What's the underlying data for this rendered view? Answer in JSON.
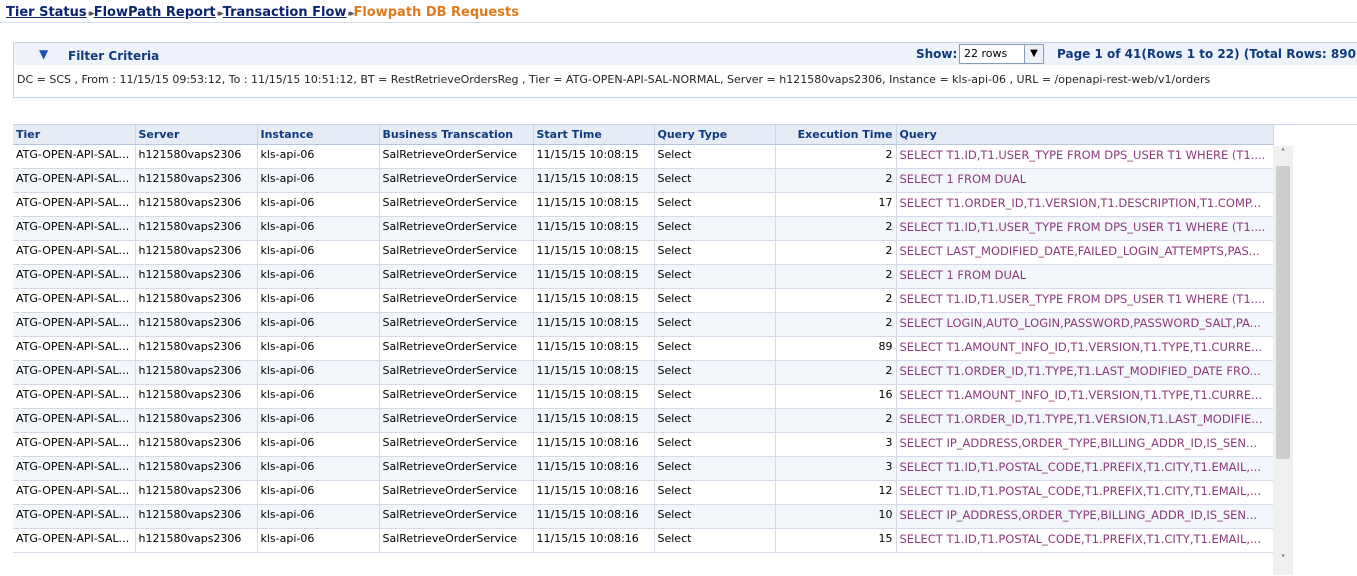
{
  "breadcrumb": {
    "items": [
      "Tier Status",
      "FlowPath Report",
      "Transaction Flow"
    ],
    "current": "Flowpath DB Requests",
    "separator": "▸▸"
  },
  "filter": {
    "title": "Filter Criteria",
    "toggle_icon": "▼",
    "show_label": "Show:",
    "show_value": "22 rows",
    "page_info": "Page 1 of 41(Rows 1 to 22) (Total Rows: 890)",
    "criteria": "DC = SCS , From : 11/15/15 09:53:12, To : 11/15/15 10:51:12, BT = RestRetrieveOrdersReg , Tier = ATG-OPEN-API-SAL-NORMAL, Server = h121580vaps2306, Instance = kls-api-06 , URL = /openapi-rest-web/v1/orders"
  },
  "table": {
    "columns": [
      "Tier",
      "Server",
      "Instance",
      "Business Transcation",
      "Start Time",
      "Query Type",
      "Execution Time",
      "Query"
    ],
    "rows": [
      [
        "ATG-OPEN-API-SAL-...",
        "h121580vaps2306",
        "kls-api-06",
        "SalRetrieveOrderService",
        "11/15/15 10:08:15",
        "Select",
        "2",
        "SELECT T1.ID,T1.USER_TYPE FROM DPS_USER T1 WHERE (T1...."
      ],
      [
        "ATG-OPEN-API-SAL-...",
        "h121580vaps2306",
        "kls-api-06",
        "SalRetrieveOrderService",
        "11/15/15 10:08:15",
        "Select",
        "2",
        "SELECT 1 FROM DUAL"
      ],
      [
        "ATG-OPEN-API-SAL-...",
        "h121580vaps2306",
        "kls-api-06",
        "SalRetrieveOrderService",
        "11/15/15 10:08:15",
        "Select",
        "17",
        "SELECT T1.ORDER_ID,T1.VERSION,T1.DESCRIPTION,T1.COMP..."
      ],
      [
        "ATG-OPEN-API-SAL-...",
        "h121580vaps2306",
        "kls-api-06",
        "SalRetrieveOrderService",
        "11/15/15 10:08:15",
        "Select",
        "2",
        "SELECT T1.ID,T1.USER_TYPE FROM DPS_USER T1 WHERE (T1...."
      ],
      [
        "ATG-OPEN-API-SAL-...",
        "h121580vaps2306",
        "kls-api-06",
        "SalRetrieveOrderService",
        "11/15/15 10:08:15",
        "Select",
        "2",
        "SELECT LAST_MODIFIED_DATE,FAILED_LOGIN_ATTEMPTS,PAS..."
      ],
      [
        "ATG-OPEN-API-SAL-...",
        "h121580vaps2306",
        "kls-api-06",
        "SalRetrieveOrderService",
        "11/15/15 10:08:15",
        "Select",
        "2",
        "SELECT 1 FROM DUAL"
      ],
      [
        "ATG-OPEN-API-SAL-...",
        "h121580vaps2306",
        "kls-api-06",
        "SalRetrieveOrderService",
        "11/15/15 10:08:15",
        "Select",
        "2",
        "SELECT T1.ID,T1.USER_TYPE FROM DPS_USER T1 WHERE (T1...."
      ],
      [
        "ATG-OPEN-API-SAL-...",
        "h121580vaps2306",
        "kls-api-06",
        "SalRetrieveOrderService",
        "11/15/15 10:08:15",
        "Select",
        "2",
        "SELECT LOGIN,AUTO_LOGIN,PASSWORD,PASSWORD_SALT,PA..."
      ],
      [
        "ATG-OPEN-API-SAL-...",
        "h121580vaps2306",
        "kls-api-06",
        "SalRetrieveOrderService",
        "11/15/15 10:08:15",
        "Select",
        "89",
        "SELECT T1.AMOUNT_INFO_ID,T1.VERSION,T1.TYPE,T1.CURRE..."
      ],
      [
        "ATG-OPEN-API-SAL-...",
        "h121580vaps2306",
        "kls-api-06",
        "SalRetrieveOrderService",
        "11/15/15 10:08:15",
        "Select",
        "2",
        "SELECT T1.ORDER_ID,T1.TYPE,T1.LAST_MODIFIED_DATE FRO..."
      ],
      [
        "ATG-OPEN-API-SAL-...",
        "h121580vaps2306",
        "kls-api-06",
        "SalRetrieveOrderService",
        "11/15/15 10:08:15",
        "Select",
        "16",
        "SELECT T1.AMOUNT_INFO_ID,T1.VERSION,T1.TYPE,T1.CURRE..."
      ],
      [
        "ATG-OPEN-API-SAL-...",
        "h121580vaps2306",
        "kls-api-06",
        "SalRetrieveOrderService",
        "11/15/15 10:08:15",
        "Select",
        "2",
        "SELECT T1.ORDER_ID,T1.TYPE,T1.VERSION,T1.LAST_MODIFIE..."
      ],
      [
        "ATG-OPEN-API-SAL-...",
        "h121580vaps2306",
        "kls-api-06",
        "SalRetrieveOrderService",
        "11/15/15 10:08:16",
        "Select",
        "3",
        "SELECT IP_ADDRESS,ORDER_TYPE,BILLING_ADDR_ID,IS_SEN..."
      ],
      [
        "ATG-OPEN-API-SAL-...",
        "h121580vaps2306",
        "kls-api-06",
        "SalRetrieveOrderService",
        "11/15/15 10:08:16",
        "Select",
        "3",
        "SELECT T1.ID,T1.POSTAL_CODE,T1.PREFIX,T1.CITY,T1.EMAIL,..."
      ],
      [
        "ATG-OPEN-API-SAL-...",
        "h121580vaps2306",
        "kls-api-06",
        "SalRetrieveOrderService",
        "11/15/15 10:08:16",
        "Select",
        "12",
        "SELECT T1.ID,T1.POSTAL_CODE,T1.PREFIX,T1.CITY,T1.EMAIL,..."
      ],
      [
        "ATG-OPEN-API-SAL-...",
        "h121580vaps2306",
        "kls-api-06",
        "SalRetrieveOrderService",
        "11/15/15 10:08:16",
        "Select",
        "10",
        "SELECT IP_ADDRESS,ORDER_TYPE,BILLING_ADDR_ID,IS_SEN..."
      ],
      [
        "ATG-OPEN-API-SAL-...",
        "h121580vaps2306",
        "kls-api-06",
        "SalRetrieveOrderService",
        "11/15/15 10:08:16",
        "Select",
        "15",
        "SELECT T1.ID,T1.POSTAL_CODE,T1.PREFIX,T1.CITY,T1.EMAIL,..."
      ]
    ]
  },
  "scrollbar": {
    "up_icon": "˄",
    "down_icon": "˅"
  }
}
